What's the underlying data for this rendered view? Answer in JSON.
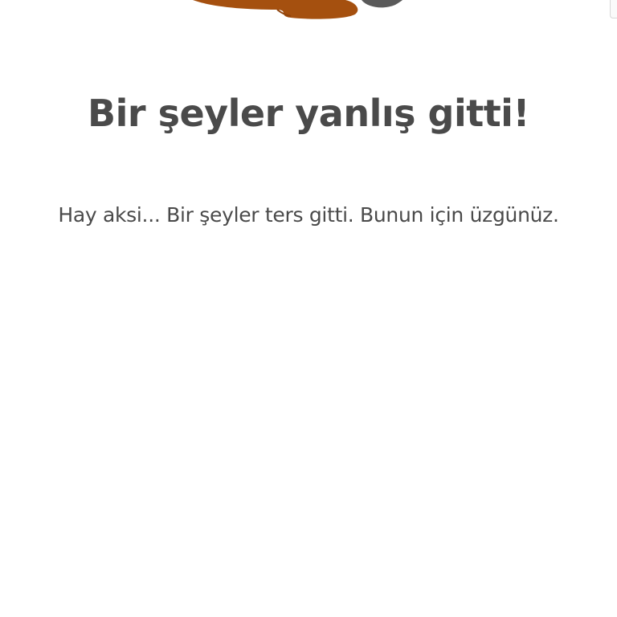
{
  "illustration": {
    "icon": "spilled-coffee-icon",
    "colors": {
      "spill": "#a5500f",
      "spill_highlight": "#8f430b",
      "cup": "#5a5a5a"
    }
  },
  "error": {
    "title": "Bir şeyler yanlış gitti!",
    "message": "Hay aksi... Bir şeyler ters gitti. Bunun için üzgünüz."
  },
  "colors": {
    "text": "#4a4a4a",
    "background": "#ffffff"
  }
}
